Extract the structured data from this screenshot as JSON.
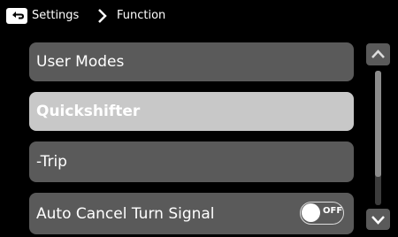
{
  "header": {
    "breadcrumb": [
      "Settings",
      "Function"
    ]
  },
  "menu": {
    "items": [
      {
        "label": "User Modes",
        "selected": false
      },
      {
        "label": "Quickshifter",
        "selected": true
      },
      {
        "label": "-Trip",
        "selected": false
      },
      {
        "label": "Auto Cancel Turn Signal",
        "selected": false,
        "toggle": "OFF"
      }
    ]
  },
  "scrollbar": {
    "position_fraction": 0.0,
    "visible_fraction": 0.79
  },
  "colors": {
    "background": "#000000",
    "item": "#5a5a5a",
    "item_selected": "#c8c8c8"
  }
}
